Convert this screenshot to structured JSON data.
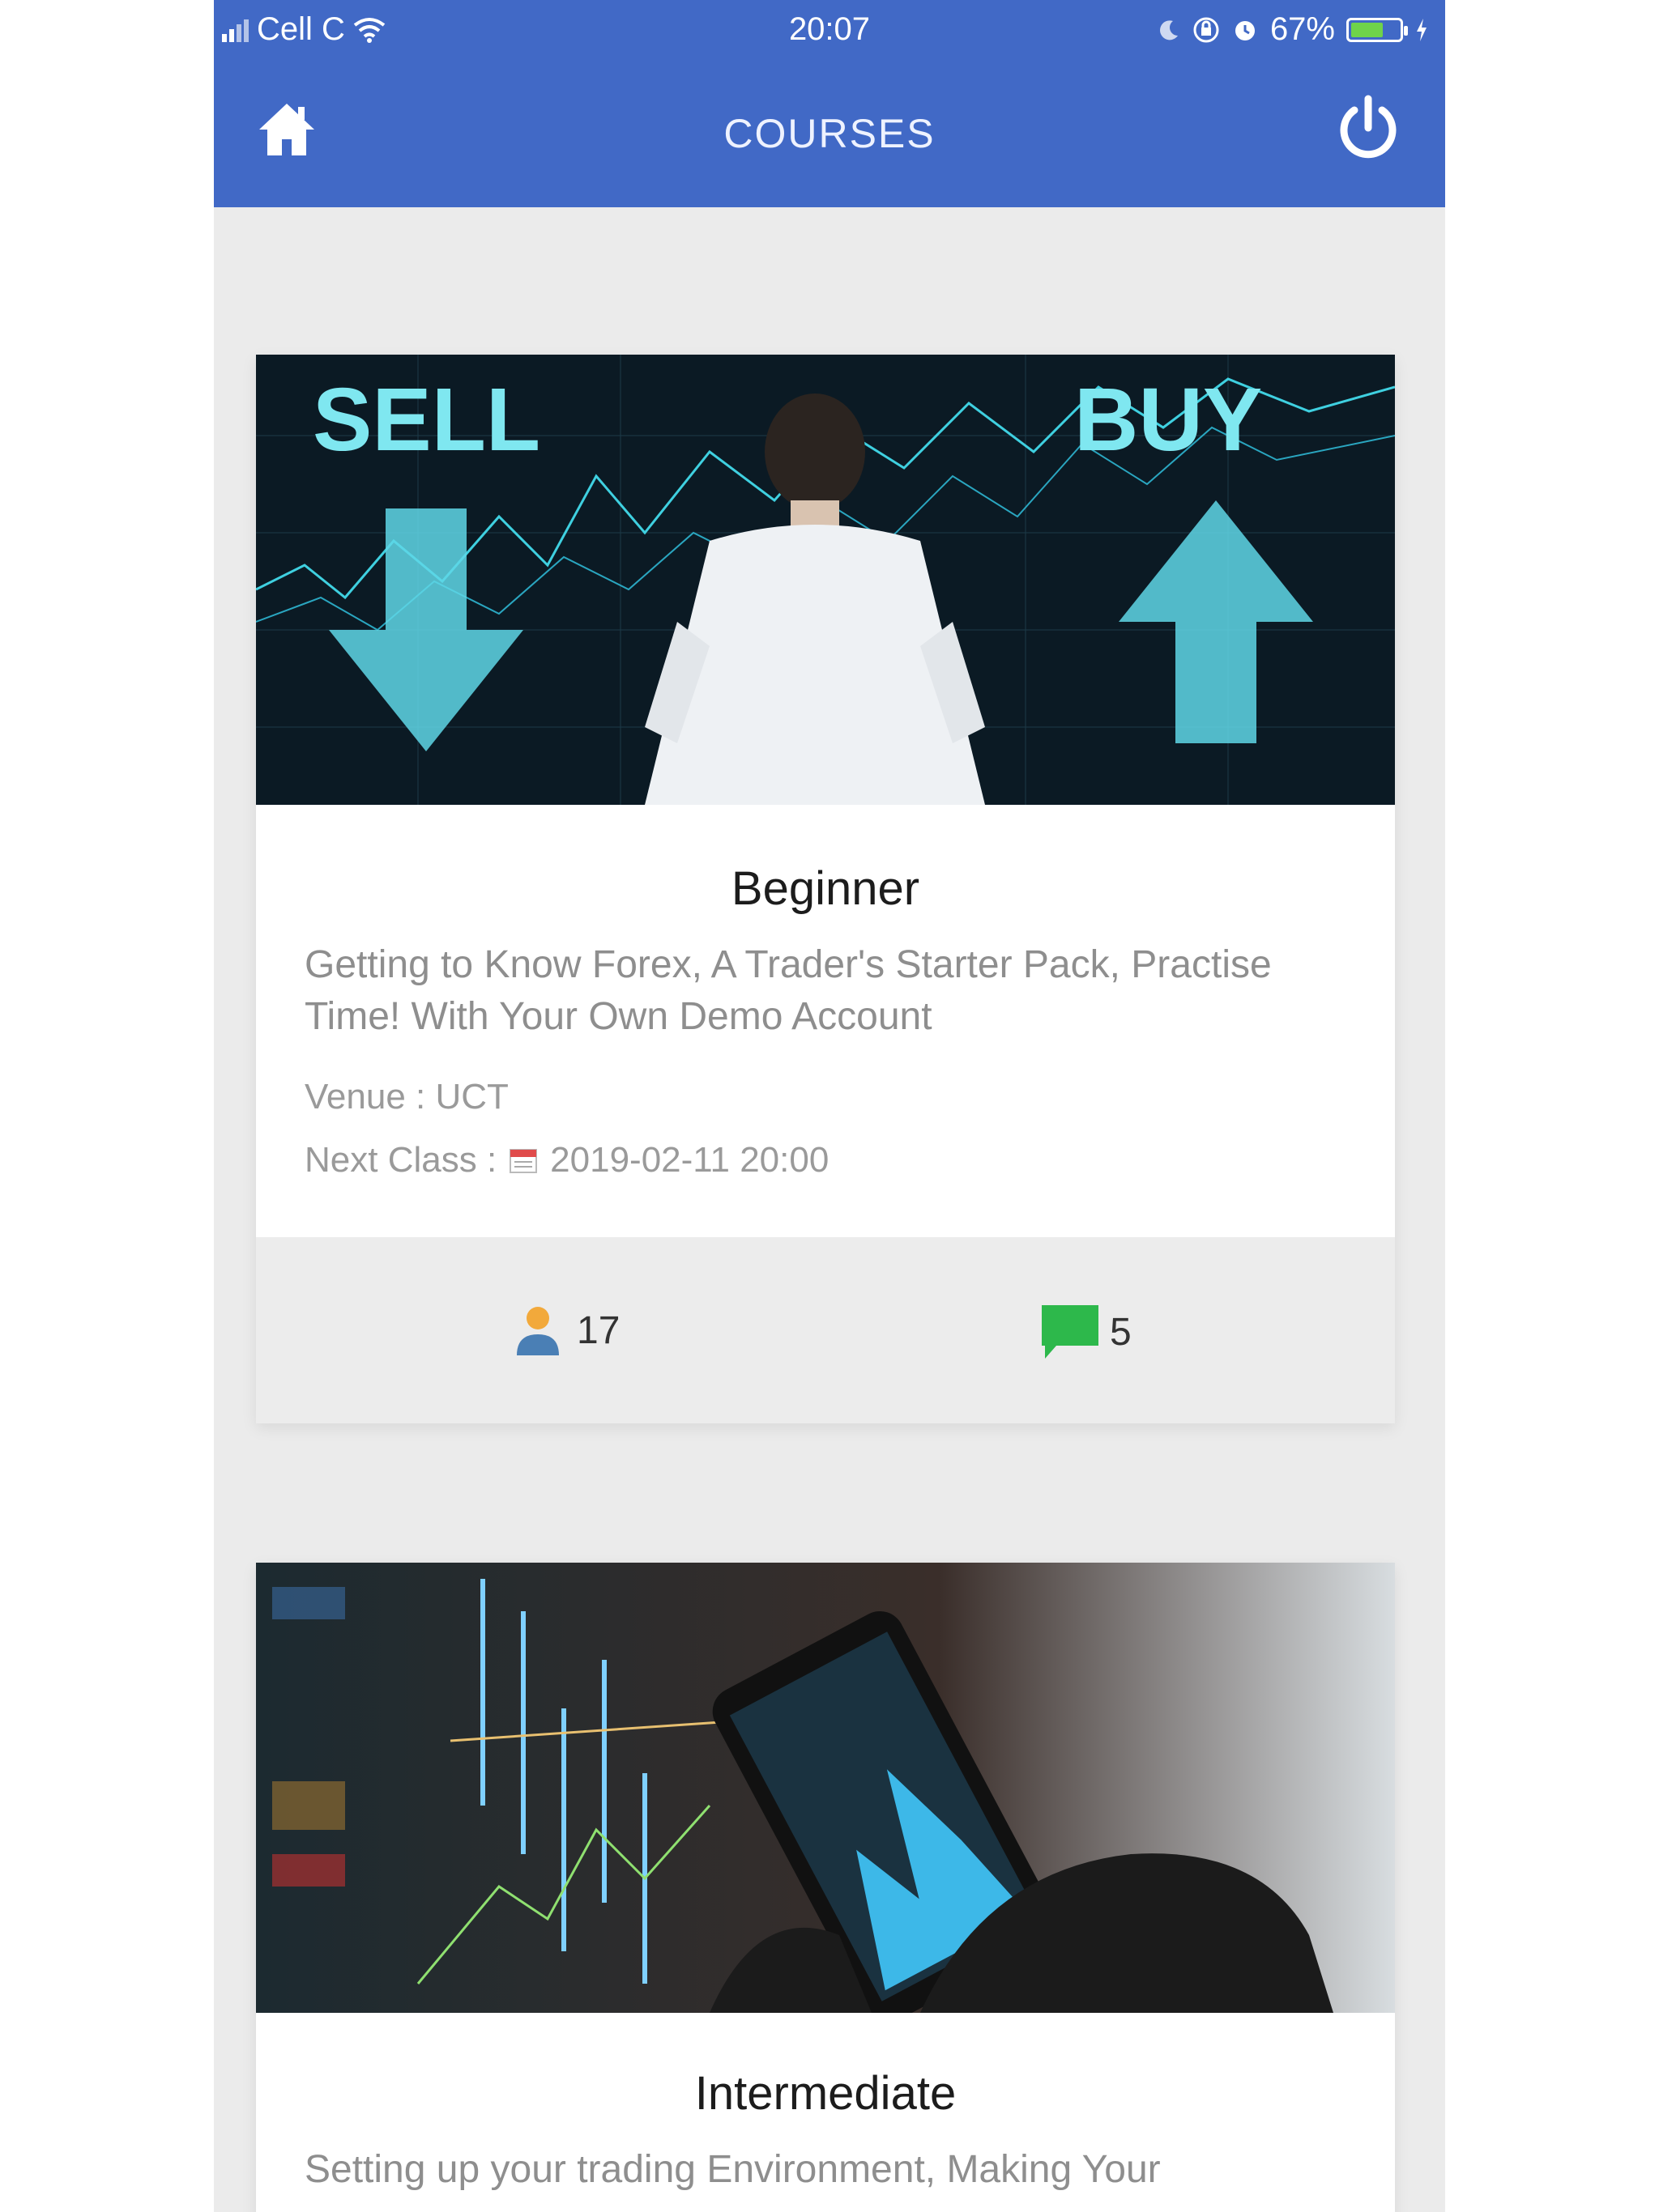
{
  "status_bar": {
    "carrier": "Cell C",
    "time": "20:07",
    "battery_percent": "67%",
    "battery_level": 0.67,
    "icons": [
      "signal-icon",
      "wifi-icon",
      "moon-icon",
      "orientation-lock-icon",
      "alarm-icon",
      "battery-icon",
      "charging-icon"
    ]
  },
  "header": {
    "title": "COURSES",
    "home_icon": "home-icon",
    "power_icon": "power-icon"
  },
  "courses": [
    {
      "title": "Beginner",
      "description": "Getting to Know Forex, A Trader's Starter Pack, Practise Time! With Your Own Demo Account",
      "venue": "Venue : UCT",
      "next_class_label": "Next Class :",
      "next_class": "2019-02-11 20:00",
      "members": "17",
      "comments": "5"
    },
    {
      "title": "Intermediate",
      "description": "Setting up your trading Environment, Making Your"
    }
  ],
  "colors": {
    "brand": "#4169c6",
    "card_footer": "#ececec",
    "page_bg": "#ebebeb",
    "member_icon": "#f2a93b",
    "comment_icon": "#2db84b"
  }
}
